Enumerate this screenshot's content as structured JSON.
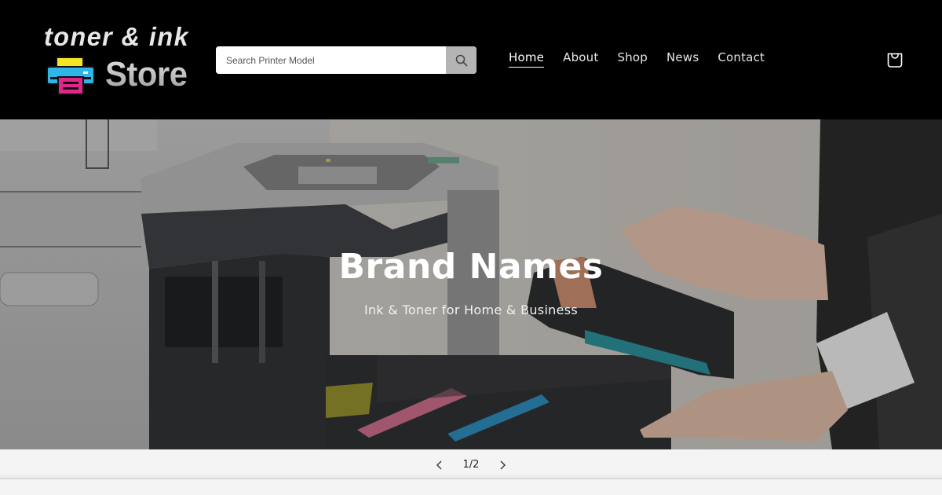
{
  "header": {
    "logo": {
      "line1": "toner & ink",
      "line2": "Store",
      "colors": {
        "yellow": "#f5e625",
        "cyan": "#2fb6e8",
        "magenta": "#e0288a"
      }
    },
    "search": {
      "placeholder": "Search Printer Model",
      "value": "",
      "button_icon": "search-icon"
    },
    "nav": {
      "items": [
        {
          "label": "Home",
          "active": true
        },
        {
          "label": "About",
          "active": false
        },
        {
          "label": "Shop",
          "active": false
        },
        {
          "label": "News",
          "active": false
        },
        {
          "label": "Contact",
          "active": false
        }
      ]
    },
    "cart_icon": "shopping-bag-icon"
  },
  "hero": {
    "title": "Brand Names",
    "subtitle": "Ink & Toner for Home & Business",
    "image": "printer-toner-replacement-photo"
  },
  "slider": {
    "counter": "1/2",
    "current": 1,
    "total": 2,
    "prev_icon": "chevron-left-icon",
    "next_icon": "chevron-right-icon"
  }
}
